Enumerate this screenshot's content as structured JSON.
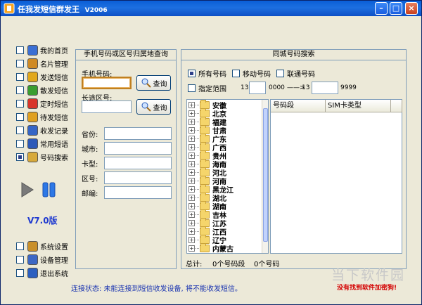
{
  "window": {
    "title": "任我发短信群发王",
    "version": "V2006"
  },
  "sidebar": {
    "items": [
      {
        "label": "我的首页",
        "icon": "home-icon",
        "color": "#3b6fd4",
        "checked": false
      },
      {
        "label": "名片管理",
        "icon": "contacts-icon",
        "color": "#cf8a24",
        "checked": false
      },
      {
        "label": "发送短信",
        "icon": "send-icon",
        "color": "#e2a81c",
        "checked": false
      },
      {
        "label": "散发短信",
        "icon": "broadcast-icon",
        "color": "#3a9d2f",
        "checked": false
      },
      {
        "label": "定时短信",
        "icon": "clock-icon",
        "color": "#d8342a",
        "checked": false
      },
      {
        "label": "待发短信",
        "icon": "pending-icon",
        "color": "#e0a020",
        "checked": false
      },
      {
        "label": "收发记录",
        "icon": "chart-icon",
        "color": "#3565c6",
        "checked": false
      },
      {
        "label": "常用短语",
        "icon": "notebook-icon",
        "color": "#2d59b8",
        "checked": false
      },
      {
        "label": "号码搜索",
        "icon": "search-icon",
        "color": "#d7a93b",
        "checked": true
      }
    ],
    "version_label": "V7.0版",
    "bottom_items": [
      {
        "label": "系统设置",
        "icon": "settings-icon",
        "color": "#c9902b"
      },
      {
        "label": "设备管理",
        "icon": "device-icon",
        "color": "#3c67c4"
      },
      {
        "label": "退出系统",
        "icon": "exit-icon",
        "color": "#2c5fc0"
      }
    ]
  },
  "lookup": {
    "title": "手机号码或区号归属地查询",
    "mobile_label": "手机号码:",
    "mobile_value": "",
    "query_label": "查询",
    "area_label": "长途区号:",
    "area_value": "",
    "fields": [
      {
        "label": "省份:",
        "value": ""
      },
      {
        "label": "城市:",
        "value": ""
      },
      {
        "label": "卡型:",
        "value": ""
      },
      {
        "label": "区号:",
        "value": ""
      },
      {
        "label": "邮编:",
        "value": ""
      }
    ]
  },
  "search": {
    "title": "同城号码搜索",
    "options": [
      {
        "label": "所有号码",
        "selected": true
      },
      {
        "label": "移动号码",
        "selected": false
      },
      {
        "label": "联通号码",
        "selected": false
      }
    ],
    "range_label": "指定范围",
    "range_from_prefix": "13",
    "range_from_value": "",
    "range_from_suffix": "0000",
    "range_arrow": "——>",
    "range_to_prefix": "13",
    "range_to_value": "",
    "range_to_suffix": "9999",
    "provinces": [
      "安徽",
      "北京",
      "福建",
      "甘肃",
      "广东",
      "广西",
      "贵州",
      "海南",
      "河北",
      "河南",
      "黑龙江",
      "湖北",
      "湖南",
      "吉林",
      "江苏",
      "江西",
      "辽宁",
      "内蒙古"
    ],
    "grid_columns": [
      "号码段",
      "SIM卡类型"
    ],
    "total_label": "总计:",
    "segments_count": "0个号码段",
    "numbers_count": "0个号码"
  },
  "status": {
    "text": "连接状态: 未能连接到短信收发设备, 将不能收发短信。",
    "warning": "没有找到软件加密狗!",
    "watermark": "当下软件园"
  }
}
